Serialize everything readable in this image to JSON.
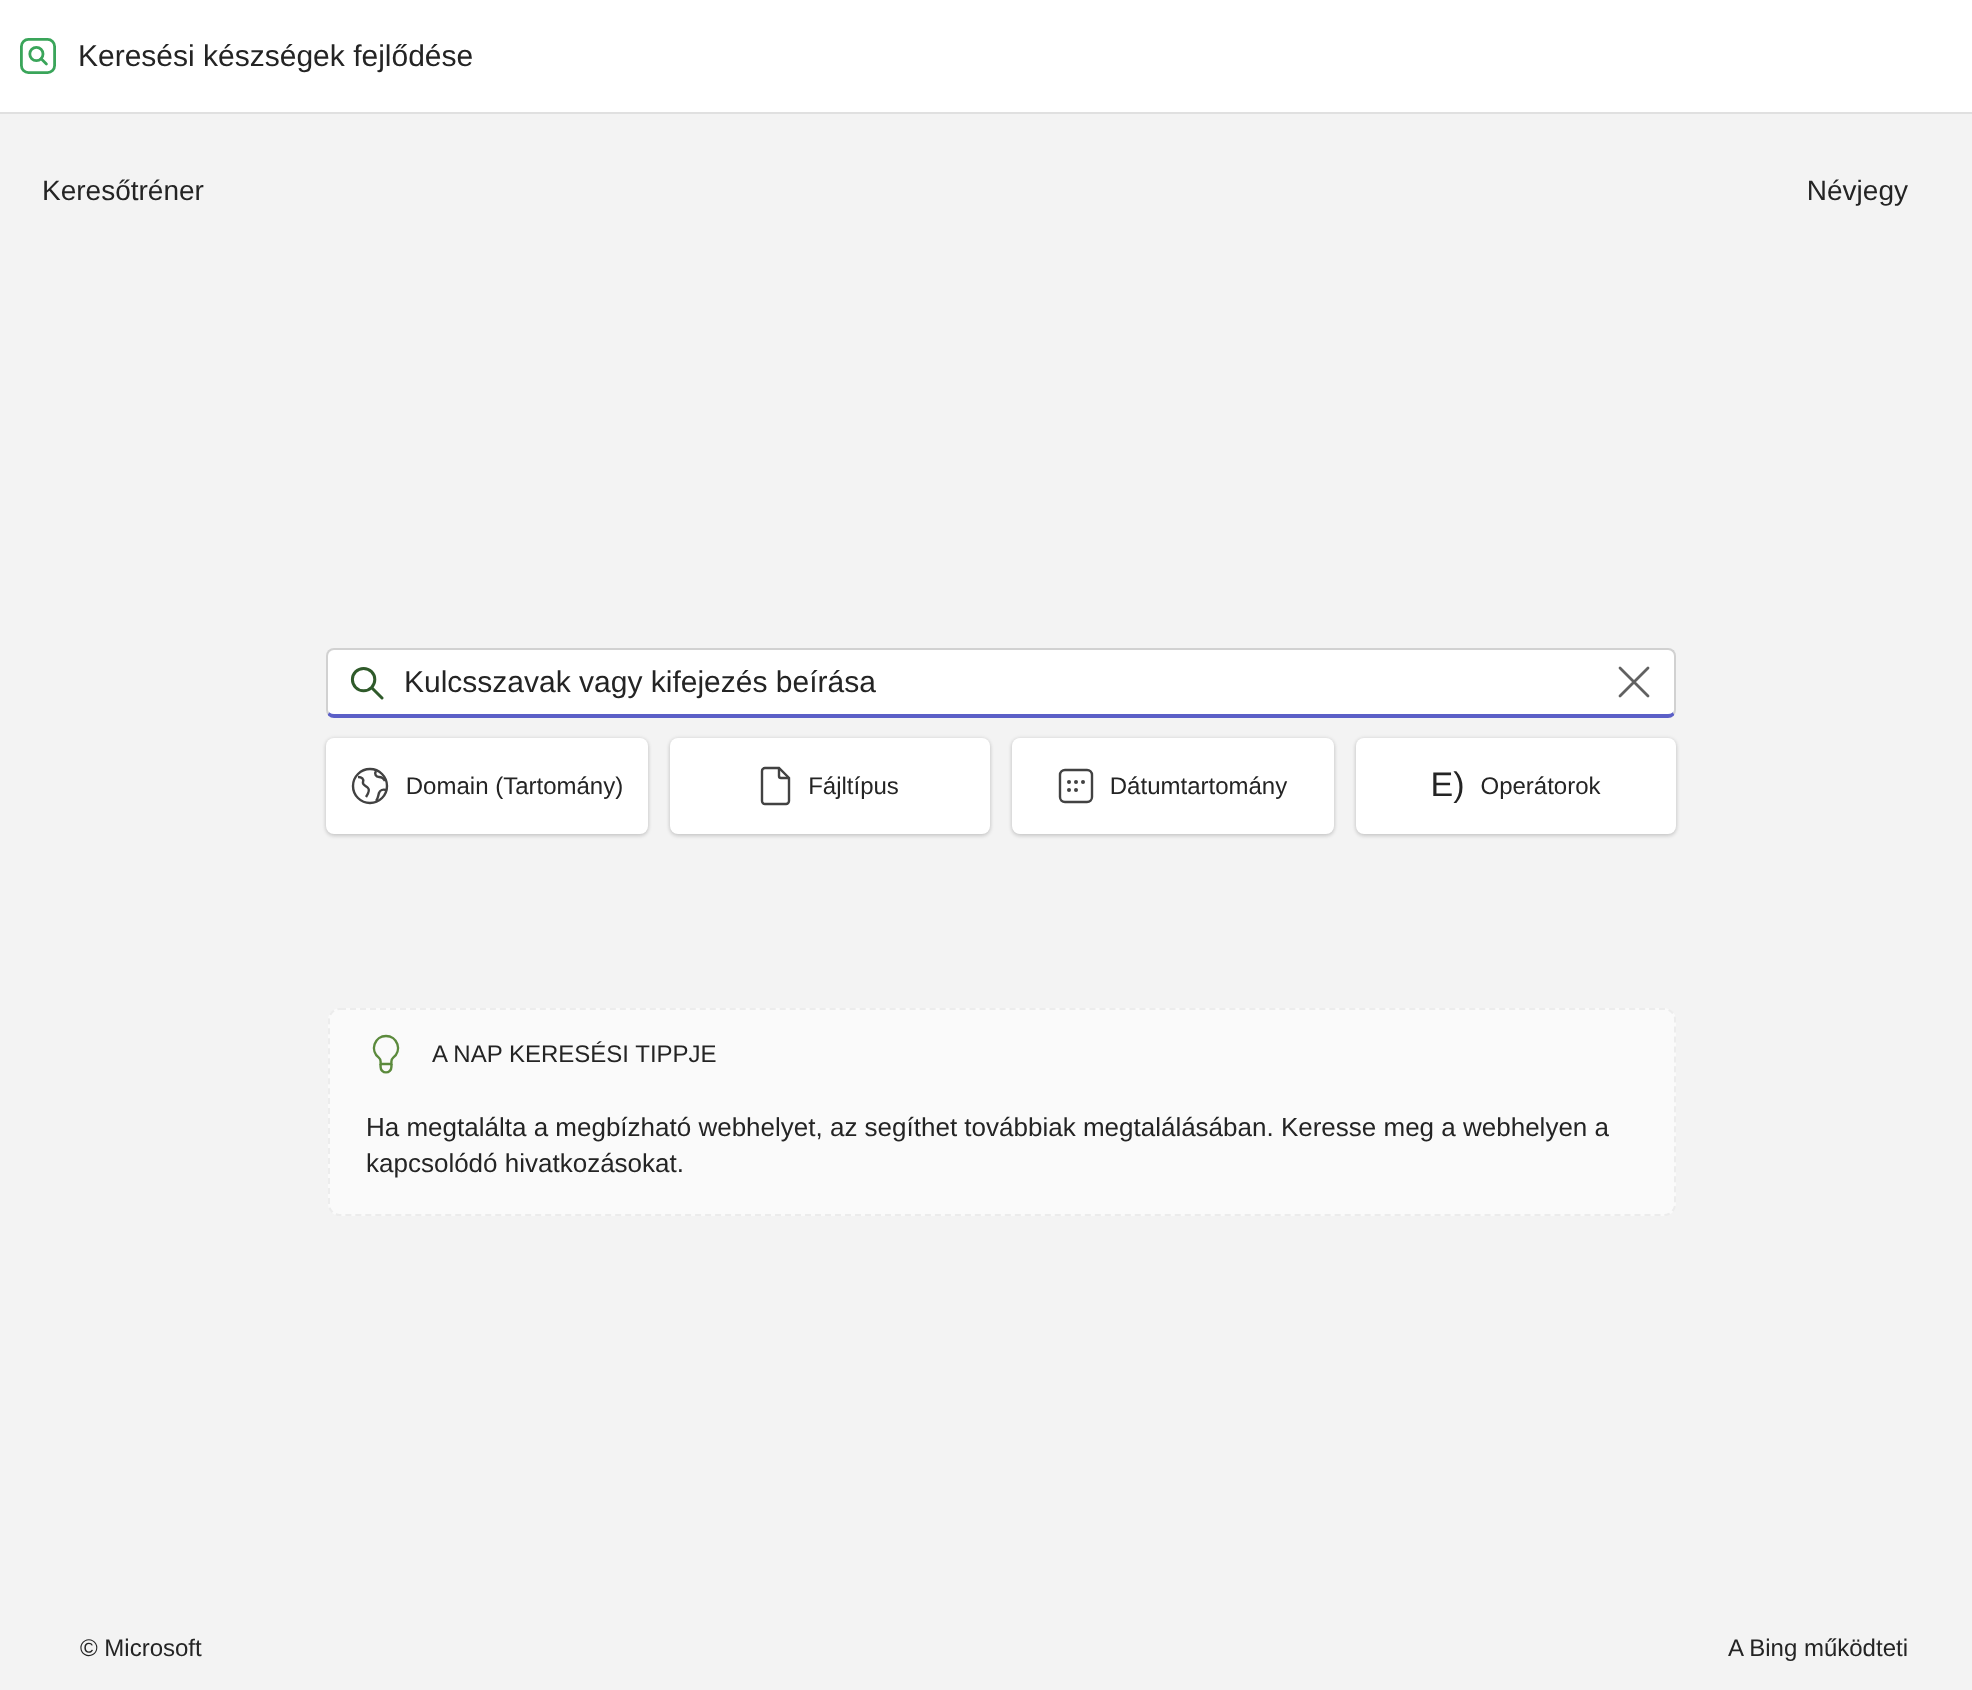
{
  "header": {
    "title": "Keresési készségek fejlődése"
  },
  "nav": {
    "left_link": "Keresőtréner",
    "right_link": "Névjegy"
  },
  "search": {
    "placeholder": "Kulcsszavak vagy kifejezés beírása",
    "focused": true
  },
  "filters": [
    {
      "kind": "globe",
      "label": "Domain (Tartomány)"
    },
    {
      "kind": "file",
      "label": "Fájltípus"
    },
    {
      "kind": "calendar",
      "label": "Dátumtartomány"
    },
    {
      "kind": "glyph",
      "glyph": "E)",
      "label": "Operátorok"
    }
  ],
  "tip": {
    "title": "A NAP KERESÉSI TIPPJE",
    "text": "Ha megtalálta a megbízható webhelyet, az segíthet továbbiak megtalálásában. Keresse meg a webhelyen a kapcsolódó hivatkozásokat."
  },
  "footer": {
    "copyright": "© Microsoft",
    "powered_by": "A Bing működteti"
  }
}
